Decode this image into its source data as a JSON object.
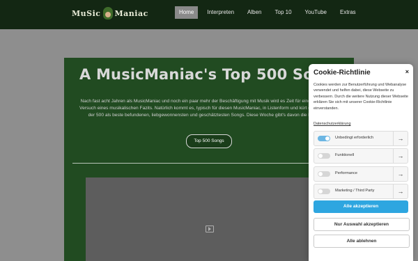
{
  "header": {
    "logo_text_left": "MuSic",
    "logo_text_right": "Maniac",
    "nav": [
      {
        "label": "Home",
        "active": true
      },
      {
        "label": "Interpreten",
        "active": false
      },
      {
        "label": "Alben",
        "active": false
      },
      {
        "label": "Top 10",
        "active": false
      },
      {
        "label": "YouTube",
        "active": false
      },
      {
        "label": "Extras",
        "active": false
      }
    ]
  },
  "hero": {
    "title": "A MusicManiac's Top 500 Songs",
    "body": "Nach fast acht Jahren als MusicManiac und noch ein paar mehr der Beschäftigung mit Musik wird es Zeit für einen unzureichenden Versuch eines musikalischen Fazits. Natürlich kommt es, typisch für diesen MusicManiac, in Listenform und kürt die verwegene Zahl der 500 als beste befundenen, liebgewonnensten und geschätztesten Songs. Diese Woche gibt's davon die Plätze 25 bis 1.",
    "button_label": "Top 500 Songs"
  },
  "cookie": {
    "title": "Cookie-Richtlinie",
    "close": "×",
    "description": "Cookies werden zur Benutzerführung und Webanalyse verwendet und helfen dabei, diese Webseite zu verbessern. Durch die weitere Nutzung dieser Webseite erklären Sie sich mit unserer Cookie-Richtlinie einverstanden.",
    "privacy_link": "Datenschutzerklärung",
    "categories": [
      {
        "label": "Unbedingt erforderlich",
        "enabled": true
      },
      {
        "label": "Funktionell",
        "enabled": false
      },
      {
        "label": "Performance",
        "enabled": false
      },
      {
        "label": "Marketing / Third Party",
        "enabled": false
      }
    ],
    "accept_all": "Alle akzeptieren",
    "accept_selection": "Nur Auswahl akzeptieren",
    "reject_all": "Alle ablehnen"
  },
  "colors": {
    "header_bg": "#132713",
    "hero_bg": "#214b21",
    "accent": "#2ea6e0"
  }
}
